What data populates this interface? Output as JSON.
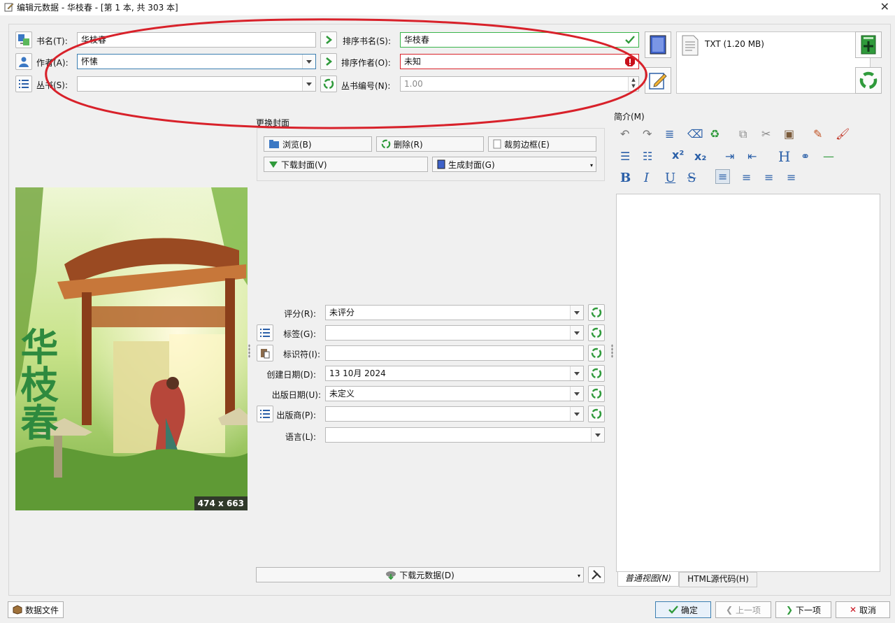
{
  "window": {
    "title": "编辑元数据 - 华枝春 - [第 1 本, 共 303 本]"
  },
  "fields": {
    "title_label": "书名(T):",
    "title_value": "华枝春",
    "author_label": "作者(A):",
    "author_value": "怀愫",
    "series_label": "丛书(S):",
    "series_value": "",
    "title_sort_label": "排序书名(S):",
    "title_sort_value": "华枝春",
    "author_sort_label": "排序作者(O):",
    "author_sort_value": "未知",
    "series_index_label": "丛书编号(N):",
    "series_index_value": "1.00"
  },
  "formats": {
    "item": "TXT (1.20 MB)"
  },
  "cover": {
    "group_title": "更换封面",
    "browse": "浏览(B)",
    "remove": "删除(R)",
    "trim": "裁剪边框(E)",
    "download": "下载封面(V)",
    "generate": "生成封面(G)",
    "size": "474 x 663",
    "art_text": "华枝春"
  },
  "meta": {
    "rating_label": "评分(R):",
    "rating_value": "未评分",
    "tags_label": "标签(G):",
    "tags_value": "",
    "ids_label": "标识符(I):",
    "ids_value": "",
    "created_label": "创建日期(D):",
    "created_value": "13 10月 2024",
    "published_label": "出版日期(U):",
    "published_value": "未定义",
    "publisher_label": "出版商(P):",
    "publisher_value": "",
    "language_label": "语言(L):",
    "language_value": ""
  },
  "download_metadata": "下载元数据(D)",
  "comments": {
    "label": "简介(M)",
    "tab_normal": "普通视图(N)",
    "tab_html": "HTML源代码(H)"
  },
  "bottom": {
    "data_files": "数据文件",
    "ok": "确定",
    "prev": "上一项",
    "next": "下一项",
    "cancel": "取消"
  },
  "colors": {
    "valid_border": "#39b54a",
    "invalid_border": "#d9222a",
    "focus_border": "#3c7fb1",
    "annotation_red": "#d8212a",
    "icon_green": "#2f9a3b",
    "icon_blue": "#2a5fa8"
  }
}
